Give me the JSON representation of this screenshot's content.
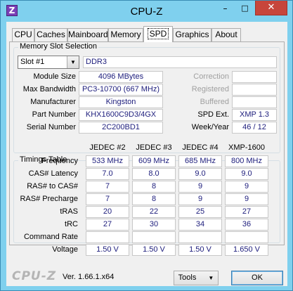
{
  "window": {
    "title": "CPU-Z",
    "icon_letter": "Z"
  },
  "tabs": [
    "CPU",
    "Caches",
    "Mainboard",
    "Memory",
    "SPD",
    "Graphics",
    "About"
  ],
  "active_tab": "SPD",
  "memory_slot": {
    "group_title": "Memory Slot Selection",
    "slot_selected": "Slot #1",
    "type": "DDR3",
    "labels": {
      "module_size": "Module Size",
      "max_bandwidth": "Max Bandwidth",
      "manufacturer": "Manufacturer",
      "part_number": "Part Number",
      "serial_number": "Serial Number",
      "correction": "Correction",
      "registered": "Registered",
      "buffered": "Buffered",
      "spd_ext": "SPD Ext.",
      "week_year": "Week/Year"
    },
    "values": {
      "module_size": "4096 MBytes",
      "max_bandwidth": "PC3-10700 (667 MHz)",
      "manufacturer": "Kingston",
      "part_number": "KHX1600C9D3/4GX",
      "serial_number": "2C200BD1",
      "spd_ext": "XMP 1.3",
      "week_year": "46 / 12"
    }
  },
  "timings": {
    "group_title": "Timings Table",
    "columns": [
      "JEDEC #2",
      "JEDEC #3",
      "JEDEC #4",
      "XMP-1600"
    ],
    "rows": [
      {
        "label": "Frequency",
        "values": [
          "533 MHz",
          "609 MHz",
          "685 MHz",
          "800 MHz"
        ]
      },
      {
        "label": "CAS# Latency",
        "values": [
          "7.0",
          "8.0",
          "9.0",
          "9.0"
        ]
      },
      {
        "label": "RAS# to CAS#",
        "values": [
          "7",
          "8",
          "9",
          "9"
        ]
      },
      {
        "label": "RAS# Precharge",
        "values": [
          "7",
          "8",
          "9",
          "9"
        ]
      },
      {
        "label": "tRAS",
        "values": [
          "20",
          "22",
          "25",
          "27"
        ]
      },
      {
        "label": "tRC",
        "values": [
          "27",
          "30",
          "34",
          "36"
        ]
      },
      {
        "label": "Command Rate",
        "values": [
          "",
          "",
          "",
          ""
        ]
      },
      {
        "label": "Voltage",
        "values": [
          "1.50 V",
          "1.50 V",
          "1.50 V",
          "1.650 V"
        ]
      }
    ]
  },
  "footer": {
    "logo": "CPU-Z",
    "version": "Ver. 1.66.1.x64",
    "tools_label": "Tools",
    "ok_label": "OK"
  }
}
